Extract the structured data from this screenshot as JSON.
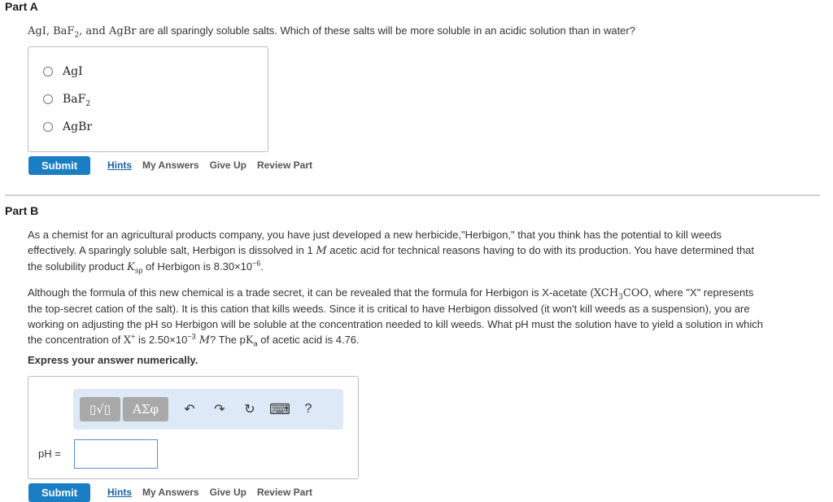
{
  "part_a": {
    "title": "Part A",
    "question_formula_1": "AgI, BaF",
    "question_sub": "2",
    "question_formula_2": ", and AgBr",
    "question_text": " are all sparingly soluble salts. Which of these salts will be more soluble in an acidic solution than in water?",
    "choices": [
      {
        "label": "AgI",
        "sub": ""
      },
      {
        "label": "BaF",
        "sub": "2"
      },
      {
        "label": "AgBr",
        "sub": ""
      }
    ],
    "submit_label": "Submit",
    "links": {
      "hints": "Hints",
      "my_answers": "My Answers",
      "give_up": "Give Up",
      "review_part": "Review Part"
    }
  },
  "part_b": {
    "title": "Part B",
    "p1_line1": "As a chemist for an agricultural products company, you have just developed a new herbicide,\"Herbigon,\" that you think has the potential to kill weeds",
    "p1_line2a": "effectively. A sparingly soluble salt, Herbigon is dissolved in 1 ",
    "p1_M": "M",
    "p1_line2b": " acetic acid for technical reasons having to do with its production. You have determined that",
    "p1_line3a": "the solubility product ",
    "p1_K": "K",
    "p1_Ksub": "sp",
    "p1_line3b": " of Herbigon is 8.30×10",
    "p1_exp": "−6",
    "p1_line3c": ".",
    "p2_line1a": "Although the formula of this new chemical is a trade secret, it can be revealed that the formula for Herbigon is X-acetate (",
    "p2_formula_a": "XCH",
    "p2_formula_sub": "3",
    "p2_formula_b": "COO",
    "p2_line1b": ", where \"X\" represents",
    "p2_line2": "the top-secret cation of the salt). It is this cation that kills weeds. Since it is critical to have Herbigon dissolved (it won't kill weeds as a suspension), you are",
    "p2_line3": "working on adjusting the pH so Herbigon will be soluble at the concentration needed to kill weeds. What pH must the solution have to yield a solution in which",
    "p2_line4a": "the concentration of ",
    "p2_X": "X",
    "p2_Xsup": "+",
    "p2_line4b": " is 2.50×10",
    "p2_exp": "−3",
    "p2_M": " M",
    "p2_line4c": "? The p",
    "p2_K": "K",
    "p2_Ksub": "a",
    "p2_line4d": " of acetic acid is 4.76.",
    "instruction": "Express your answer numerically.",
    "toolbar": {
      "templates": "▯√▯",
      "greek": "ΑΣφ",
      "undo": "↶",
      "redo": "↷",
      "reset": "↻",
      "keyboard": "⌨",
      "help": "?"
    },
    "input_label": "pH =",
    "input_value": "",
    "submit_label": "Submit",
    "links": {
      "hints": "Hints",
      "my_answers": "My Answers",
      "give_up": "Give Up",
      "review_part": "Review Part"
    }
  }
}
